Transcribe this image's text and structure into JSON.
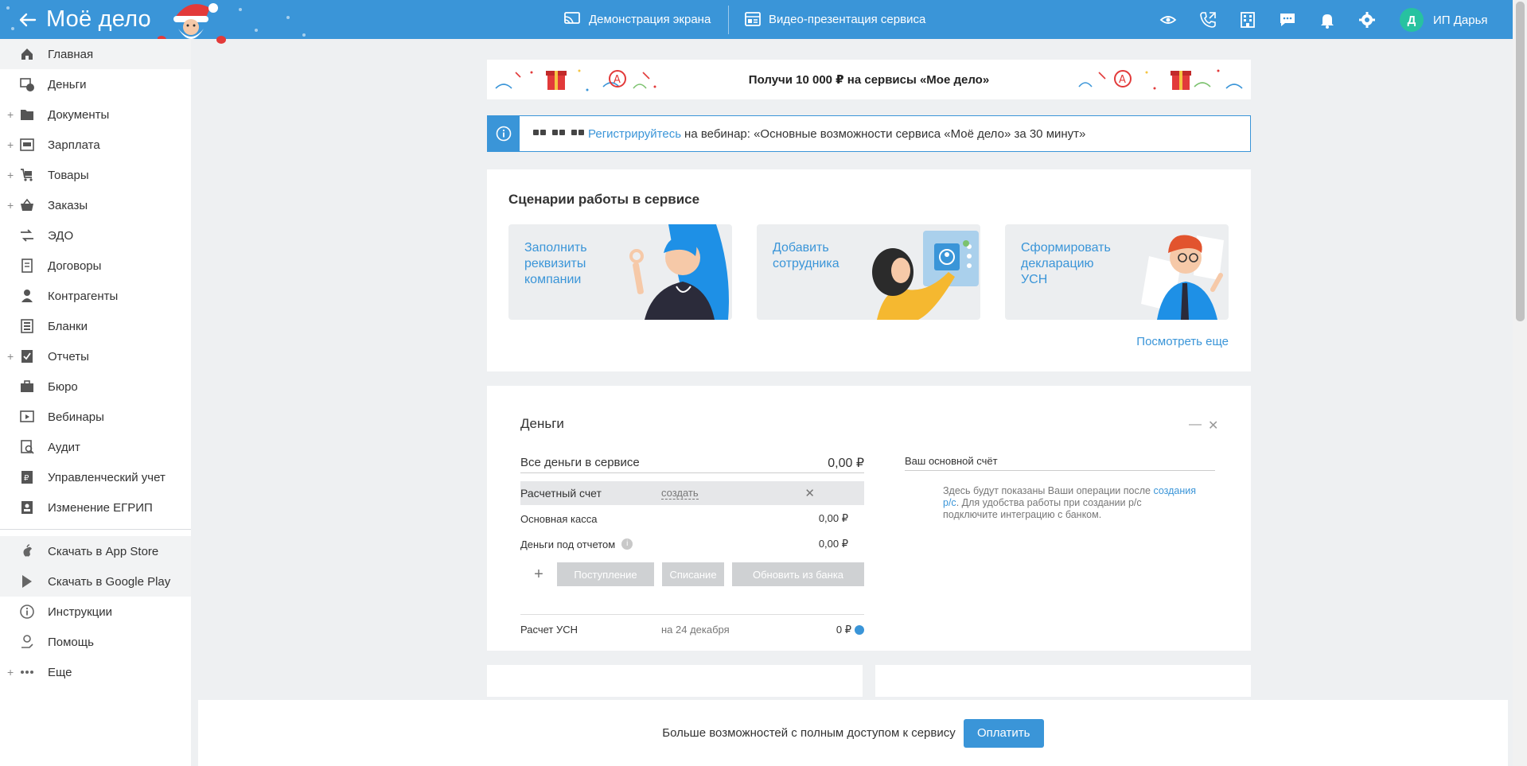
{
  "app": {
    "logo": "Моё дело"
  },
  "topnav": {
    "screen_demo": "Демонстрация экрана",
    "video_presentation": "Видео-презентация сервиса"
  },
  "user": {
    "initial": "Д",
    "name": "ИП Дарья"
  },
  "sidebar": {
    "items": [
      {
        "label": "Главная",
        "icon": "home-icon",
        "expandable": false
      },
      {
        "label": "Деньги",
        "icon": "money-icon",
        "expandable": false
      },
      {
        "label": "Документы",
        "icon": "folder-icon",
        "expandable": true
      },
      {
        "label": "Зарплата",
        "icon": "salary-icon",
        "expandable": true
      },
      {
        "label": "Товары",
        "icon": "cart-icon",
        "expandable": true
      },
      {
        "label": "Заказы",
        "icon": "basket-icon",
        "expandable": true
      },
      {
        "label": "ЭДО",
        "icon": "edo-icon",
        "expandable": false
      },
      {
        "label": "Договоры",
        "icon": "contracts-icon",
        "expandable": false
      },
      {
        "label": "Контрагенты",
        "icon": "contractors-icon",
        "expandable": false
      },
      {
        "label": "Бланки",
        "icon": "forms-icon",
        "expandable": false
      },
      {
        "label": "Отчеты",
        "icon": "reports-icon",
        "expandable": true
      },
      {
        "label": "Бюро",
        "icon": "briefcase-icon",
        "expandable": false
      },
      {
        "label": "Вебинары",
        "icon": "webinar-icon",
        "expandable": false
      },
      {
        "label": "Аудит",
        "icon": "audit-icon",
        "expandable": false
      },
      {
        "label": "Управленческий учет",
        "icon": "management-icon",
        "expandable": false
      },
      {
        "label": "Изменение ЕГРИП",
        "icon": "egrip-icon",
        "expandable": false
      }
    ],
    "bottom_items": [
      {
        "label": "Скачать в App Store",
        "icon": "apple-icon",
        "expandable": false
      },
      {
        "label": "Скачать в Google Play",
        "icon": "google-play-icon",
        "expandable": false
      },
      {
        "label": "Инструкции",
        "icon": "info-icon",
        "expandable": false
      },
      {
        "label": "Помощь",
        "icon": "help-icon",
        "expandable": false
      },
      {
        "label": "Еще",
        "icon": "more-icon",
        "expandable": true
      }
    ]
  },
  "promo": {
    "text": "Получи 10 000 ₽ на сервисы «Мое дело»"
  },
  "webinar": {
    "link": "Регистрируйтесь",
    "text": "на вебинар: «Основные возможности сервиса «Моё дело» за 30 минут»"
  },
  "scenarios": {
    "title": "Сценарии работы в сервисе",
    "cards": [
      {
        "label": "Заполнить реквизиты компании"
      },
      {
        "label": "Добавить сотрудника"
      },
      {
        "label": "Сформировать декларацию УСН"
      }
    ],
    "more": "Посмотреть еще"
  },
  "money": {
    "title": "Деньги",
    "total_label": "Все деньги в сервисе",
    "total_value": "0,00 ₽",
    "account_label": "Расчетный счет",
    "account_create": "создать",
    "cash_label": "Основная касса",
    "cash_value": "0,00 ₽",
    "report_label": "Деньги под отчетом",
    "report_value": "0,00 ₽",
    "buttons": {
      "income": "Поступление",
      "expense": "Списание",
      "bank": "Обновить из банка"
    },
    "usn_label": "Расчет УСН",
    "usn_date": "на 24 декабря",
    "usn_value": "0 ₽",
    "main_account_title": "Ваш основной счёт",
    "note_start": "Здесь будут показаны Ваши операции после",
    "note_link": "создания р/с",
    "note_end": ". Для удобства работы при создании р/с подключите интеграцию с банком."
  },
  "footer": {
    "text": "Больше возможностей с полным доступом к сервису",
    "pay_button": "Оплатить"
  },
  "colors": {
    "accent": "#3a95d8",
    "avatar": "#27c2a0"
  }
}
